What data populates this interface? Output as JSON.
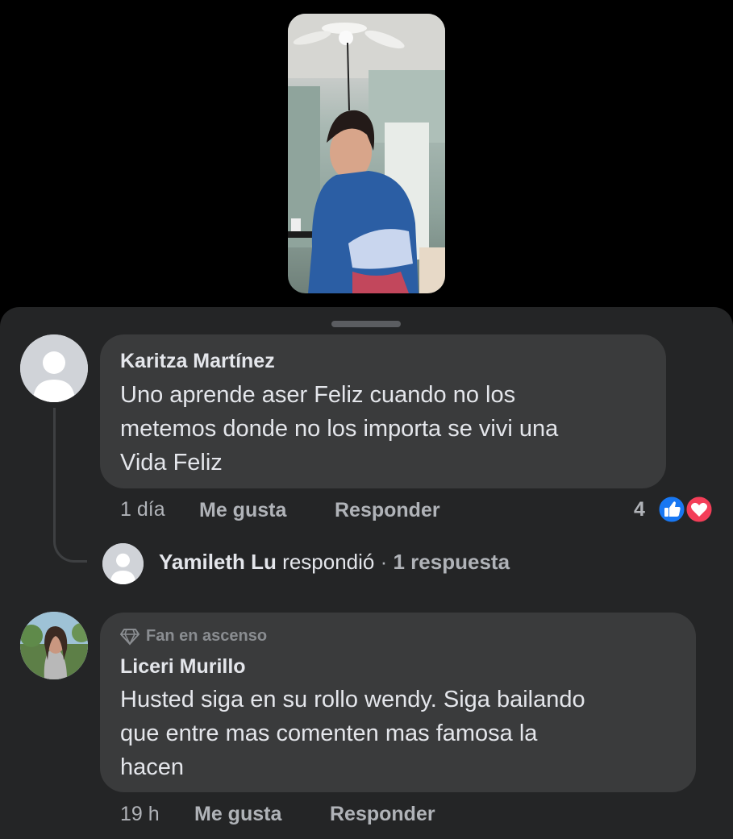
{
  "video": {
    "description_icon": "video-thumbnail"
  },
  "comments": [
    {
      "author": "Karitza Martínez",
      "text": "Uno aprende aser Feliz cuando no los metemos donde no los importa se vivi una Vida Feliz",
      "text_lines": [
        "Uno aprende aser Feliz cuando no los",
        "metemos donde no los importa se vivi una",
        "Vida Feliz"
      ],
      "time": "1 día",
      "like_label": "Me gusta",
      "reply_label": "Responder",
      "reaction_count": "4",
      "reactions": [
        "like-icon",
        "love-icon"
      ]
    },
    {
      "badge": "Fan en ascenso",
      "author": "Liceri Murillo",
      "text": "Husted siga en su rollo wendy. Siga bailando que entre mas comenten mas famosa la hacen",
      "text_lines": [
        "Husted siga en su rollo wendy. Siga bailando",
        "que entre mas comenten mas famosa la",
        "hacen"
      ],
      "time": "19 h",
      "like_label": "Me gusta",
      "reply_label": "Responder"
    }
  ],
  "reply_summary": {
    "name": "Yamileth Lu",
    "action": "respondió",
    "separator": "·",
    "count": "1 respuesta"
  },
  "colors": {
    "background": "#000000",
    "sheet": "#242526",
    "bubble": "#3a3b3c",
    "primary_text": "#e4e6eb",
    "secondary_text": "#b0b3b8",
    "like_blue": "#1877f2",
    "love_red": "#f33e58"
  }
}
